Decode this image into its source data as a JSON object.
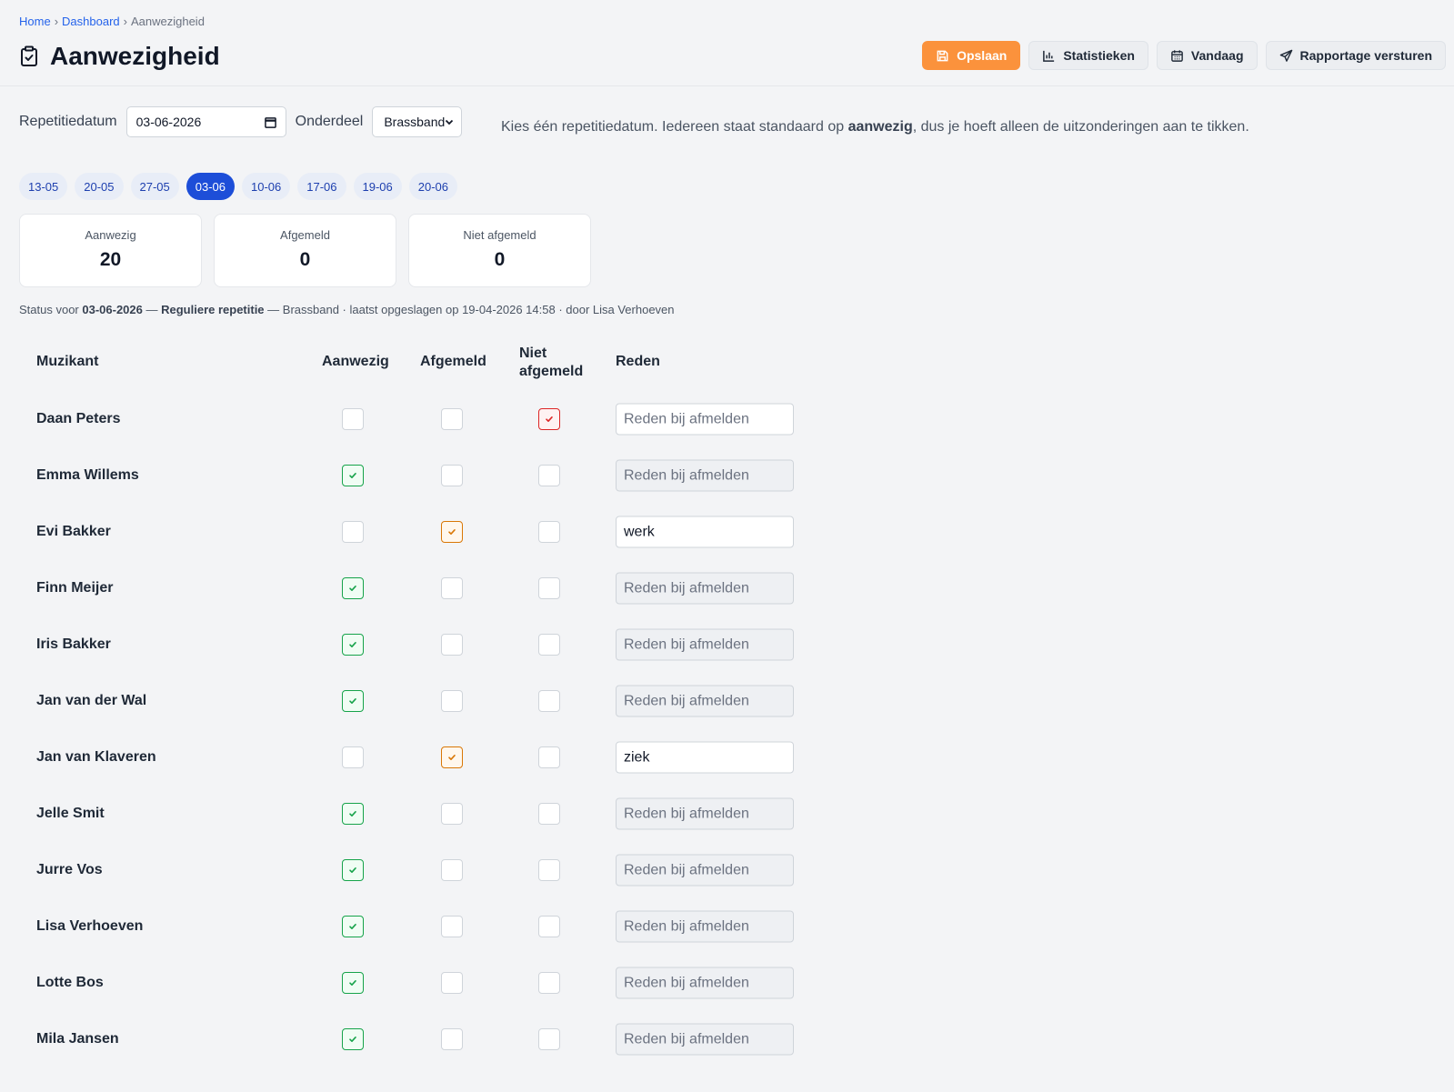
{
  "breadcrumb": {
    "home": "Home",
    "dashboard": "Dashboard",
    "current": "Aanwezigheid",
    "sep": "›"
  },
  "page": {
    "title": "Aanwezigheid"
  },
  "actions": {
    "save": "Opslaan",
    "stats": "Statistieken",
    "today": "Vandaag",
    "report": "Rapportage versturen"
  },
  "filters": {
    "date_label": "Repetitiedatum",
    "date_value": "03-06-2026",
    "section_label": "Onderdeel",
    "section_value": "Brassband"
  },
  "help": {
    "prefix": "Kies één repetitiedatum. Iedereen staat standaard op ",
    "bold": "aanwezig",
    "suffix": ", dus je hoeft alleen de uitzonderingen aan te tikken."
  },
  "dates": [
    "13-05",
    "20-05",
    "27-05",
    "03-06",
    "10-06",
    "17-06",
    "19-06",
    "20-06"
  ],
  "active_date_index": 3,
  "stats": [
    {
      "label": "Aanwezig",
      "value": "20"
    },
    {
      "label": "Afgemeld",
      "value": "0"
    },
    {
      "label": "Niet afgemeld",
      "value": "0"
    }
  ],
  "status": {
    "prefix": "Status voor ",
    "date": "03-06-2026",
    "sep1": " — ",
    "type": "Reguliere repetitie",
    "rest": " — Brassband · laatst opgeslagen op 19-04-2026 14:58 · door Lisa Verhoeven"
  },
  "table": {
    "headers": {
      "name": "Muzikant",
      "present": "Aanwezig",
      "excused": "Afgemeld",
      "not_excused_1": "Niet",
      "not_excused_2": "afgemeld",
      "reason": "Reden"
    },
    "placeholder": "Reden bij afmelden",
    "rows": [
      {
        "name": "Daan Peters",
        "state": "not_excused",
        "reason": ""
      },
      {
        "name": "Emma Willems",
        "state": "present",
        "reason": ""
      },
      {
        "name": "Evi Bakker",
        "state": "excused",
        "reason": "werk"
      },
      {
        "name": "Finn Meijer",
        "state": "present",
        "reason": ""
      },
      {
        "name": "Iris Bakker",
        "state": "present",
        "reason": ""
      },
      {
        "name": "Jan van der Wal",
        "state": "present",
        "reason": ""
      },
      {
        "name": "Jan van Klaveren",
        "state": "excused",
        "reason": "ziek"
      },
      {
        "name": "Jelle Smit",
        "state": "present",
        "reason": ""
      },
      {
        "name": "Jurre Vos",
        "state": "present",
        "reason": ""
      },
      {
        "name": "Lisa Verhoeven",
        "state": "present",
        "reason": ""
      },
      {
        "name": "Lotte Bos",
        "state": "present",
        "reason": ""
      },
      {
        "name": "Mila Jansen",
        "state": "present",
        "reason": ""
      }
    ]
  },
  "colors": {
    "primary": "#fb923c",
    "accent": "#1d4ed8",
    "present": "#16a34a",
    "excused": "#d97706",
    "not_excused": "#dc2626"
  }
}
